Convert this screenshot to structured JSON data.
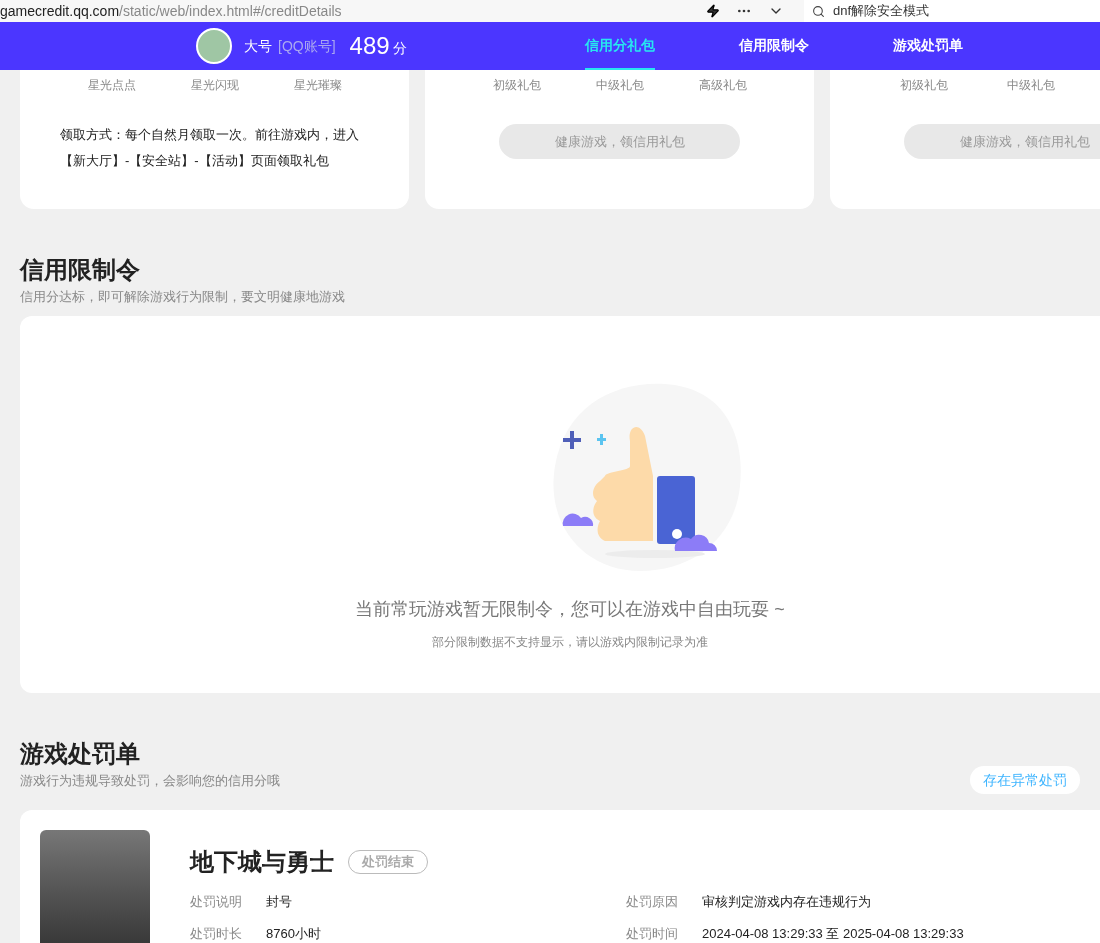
{
  "browser": {
    "url_host": "gamecredit.qq.com",
    "url_path": "/static/web/index.html#/creditDetails",
    "search_value": "dnf解除安全模式"
  },
  "header": {
    "name": "大号",
    "account_type": "[QQ账号]",
    "score": "489",
    "score_unit": "分",
    "tabs": [
      {
        "label": "信用分礼包",
        "selected": true
      },
      {
        "label": "信用限制令",
        "selected": false
      },
      {
        "label": "游戏处罚单",
        "selected": false
      }
    ]
  },
  "gift_cards": [
    {
      "tiers": [
        "星光点点",
        "星光闪现",
        "星光璀璨"
      ],
      "note": "领取方式：每个自然月领取一次。前往游戏内，进入【新大厅】-【安全站】-【活动】页面领取礼包"
    },
    {
      "tiers": [
        "初级礼包",
        "中级礼包",
        "高级礼包"
      ],
      "button": {
        "label": "健康游戏，领信用礼包",
        "disabled": true
      }
    },
    {
      "tiers": [
        "初级礼包",
        "中级礼包"
      ],
      "button": {
        "label": "健康游戏，领信用礼包",
        "disabled": true
      }
    }
  ],
  "restrictions": {
    "title": "信用限制令",
    "subtitle": "信用分达标，即可解除游戏行为限制，要文明健康地游戏",
    "empty_message": "当前常玩游戏暂无限制令，您可以在游戏中自由玩耍 ~",
    "empty_note": "部分限制数据不支持显示，请以游戏内限制记录为准"
  },
  "penalties": {
    "title": "游戏处罚单",
    "subtitle": "游戏行为违规导致处罚，会影响您的信用分哦",
    "abnormal_button": "存在异常处罚",
    "items": [
      {
        "game": "地下城与勇士",
        "status": "处罚结束",
        "fields": [
          {
            "label": "处罚说明",
            "value": "封号"
          },
          {
            "label": "处罚原因",
            "value": "审核判定游戏内存在违规行为"
          },
          {
            "label": "处罚时长",
            "value": "8760小时"
          },
          {
            "label": "处罚时间",
            "value": "2024-04-08 13:29:33 至 2025-04-08 13:29:33"
          }
        ]
      }
    ]
  }
}
